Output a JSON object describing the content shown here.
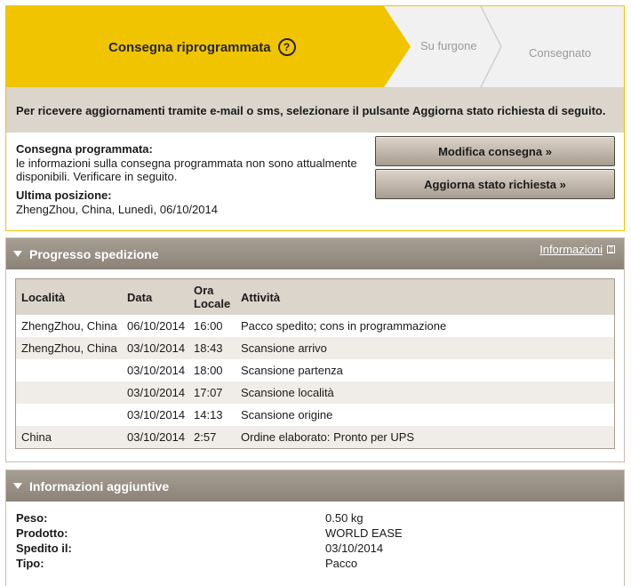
{
  "status": {
    "steps": [
      {
        "label": "Consegna riprogrammata",
        "state": "current"
      },
      {
        "label": "Su furgone",
        "state": "pending"
      },
      {
        "label": "Consegnato",
        "state": "pending"
      }
    ],
    "help_glyph": "?",
    "notice": "Per ricevere aggiornamenti tramite e-mail o sms, selezionare il pulsante Aggiorna stato richiesta di seguito.",
    "scheduled_label": "Consegna programmata:",
    "scheduled_text": "le informazioni sulla consegna programmata non sono attualmente disponibili. Verificare in seguito.",
    "last_position_label": "Ultima posizione:",
    "last_position_text": "ZhengZhou, China, Lunedì, 06/10/2014",
    "modify_button": "Modifica consegna »",
    "update_button": "Aggiorna stato richiesta »",
    "colors": {
      "accent": "#f1c400",
      "pending": "#f1f1f1"
    }
  },
  "progress": {
    "title": "Progresso spedizione",
    "info_link": "Informazioni",
    "columns": [
      "Località",
      "Data",
      "Ora Locale",
      "Attività"
    ],
    "rows": [
      [
        "ZhengZhou, China",
        "06/10/2014",
        "16:00",
        "Pacco spedito; cons in programmazione"
      ],
      [
        "ZhengZhou, China",
        "03/10/2014",
        "18:43",
        "Scansione arrivo"
      ],
      [
        "",
        "03/10/2014",
        "18:00",
        "Scansione partenza"
      ],
      [
        "",
        "03/10/2014",
        "17:07",
        "Scansione località"
      ],
      [
        "",
        "03/10/2014",
        "14:13",
        "Scansione origine"
      ],
      [
        "China",
        "03/10/2014",
        "2:57",
        "Ordine elaborato: Pronto per UPS"
      ]
    ]
  },
  "extra": {
    "title": "Informazioni aggiuntive",
    "fields": [
      {
        "label": "Peso:",
        "value": "0.50 kg"
      },
      {
        "label": "Prodotto:",
        "value": "WORLD EASE"
      },
      {
        "label": "Spedito il:",
        "value": "03/10/2014"
      },
      {
        "label": "Tipo:",
        "value": "Pacco"
      }
    ]
  }
}
